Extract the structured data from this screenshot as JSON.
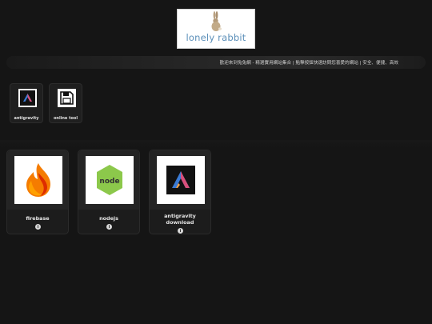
{
  "header": {
    "logo_text": "lonely rabbit",
    "marquee": "歡迎來到兔兔網 - 精選實用網站集合 | 點擊按鈕快速訪問您喜愛的網站 | 安全、便捷、高效"
  },
  "shortcuts": [
    {
      "label": "antigravity",
      "icon": "antigravity-icon"
    },
    {
      "label": "online tool",
      "icon": "floppy-disk-icon"
    }
  ],
  "cards": [
    {
      "title": "firebase",
      "icon": "firebase-icon",
      "info": "i"
    },
    {
      "title": "nodejs",
      "icon": "nodejs-icon",
      "info": "i"
    },
    {
      "title_line1": "antigravity",
      "title_line2": "download",
      "icon": "antigravity-icon",
      "info": "i"
    }
  ],
  "colors": {
    "background": "#151515",
    "logo_text": "#5b8fb9",
    "firebase_orange": "#f57c00",
    "firebase_red": "#dd2c00",
    "nodejs_green": "#8cc84b"
  }
}
